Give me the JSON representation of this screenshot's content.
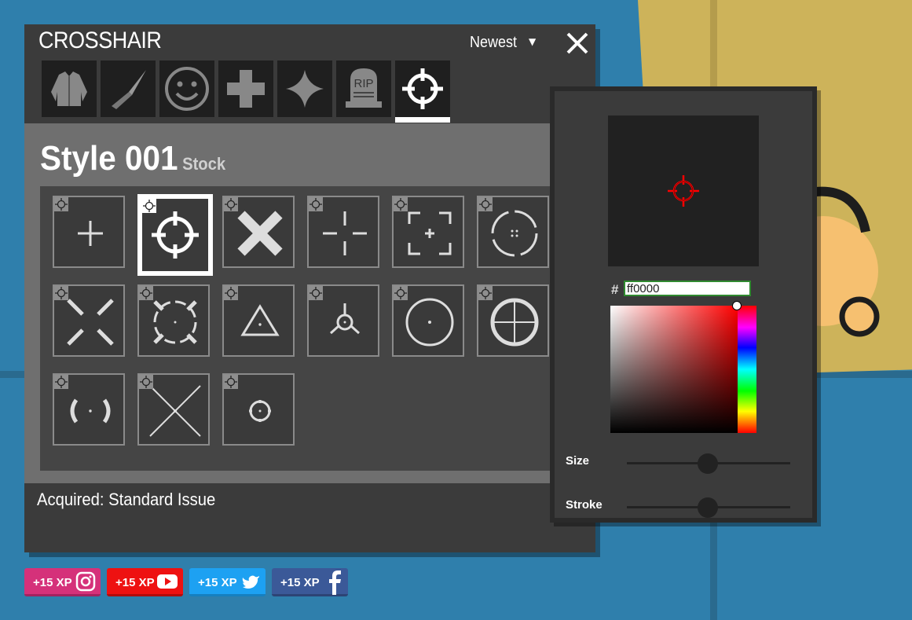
{
  "window": {
    "title": "CROSSHAIR",
    "sort_label": "Newest",
    "close_icon": "close-icon"
  },
  "tabs": [
    {
      "icon": "outfit-icon",
      "active": false
    },
    {
      "icon": "knife-icon",
      "active": false
    },
    {
      "icon": "emote-icon",
      "active": false
    },
    {
      "icon": "heal-icon",
      "active": false
    },
    {
      "icon": "sparkle-icon",
      "active": false
    },
    {
      "icon": "deathmarker-icon",
      "active": false,
      "text": "RIP"
    },
    {
      "icon": "crosshair-icon",
      "active": true
    }
  ],
  "selected": {
    "name": "Style 001",
    "tag": "Stock",
    "acquired": "Acquired: Standard Issue"
  },
  "crosshairs": [
    {
      "icon": "plus-crosshair-icon"
    },
    {
      "icon": "scope-crosshair-icon",
      "selected": true
    },
    {
      "icon": "x-crosshair-icon"
    },
    {
      "icon": "gap-plus-crosshair-icon"
    },
    {
      "icon": "bracket-crosshair-icon"
    },
    {
      "icon": "broken-circle-crosshair-icon"
    },
    {
      "icon": "diagonal-crosshair-icon"
    },
    {
      "icon": "tick-circle-crosshair-icon"
    },
    {
      "icon": "triangle-crosshair-icon"
    },
    {
      "icon": "tri-spoke-crosshair-icon"
    },
    {
      "icon": "circle-dot-crosshair-icon"
    },
    {
      "icon": "circle-cross-crosshair-icon"
    },
    {
      "icon": "parenthesis-crosshair-icon"
    },
    {
      "icon": "big-x-crosshair-icon"
    },
    {
      "icon": "small-circle-crosshair-icon"
    }
  ],
  "picker": {
    "hash": "#",
    "hex": "ff0000",
    "color": "#ff0000",
    "size_label": "Size",
    "stroke_label": "Stroke",
    "size_value": 0.5,
    "stroke_value": 0.5
  },
  "social": [
    {
      "label": "+15 XP",
      "icon": "instagram-icon",
      "color": "#d5317a"
    },
    {
      "label": "+15 XP",
      "icon": "youtube-icon",
      "color": "#ee1111"
    },
    {
      "label": "+15 XP",
      "icon": "twitter-icon",
      "color": "#1da1f2"
    },
    {
      "label": "+15 XP",
      "icon": "facebook-icon",
      "color": "#3b5998"
    }
  ]
}
